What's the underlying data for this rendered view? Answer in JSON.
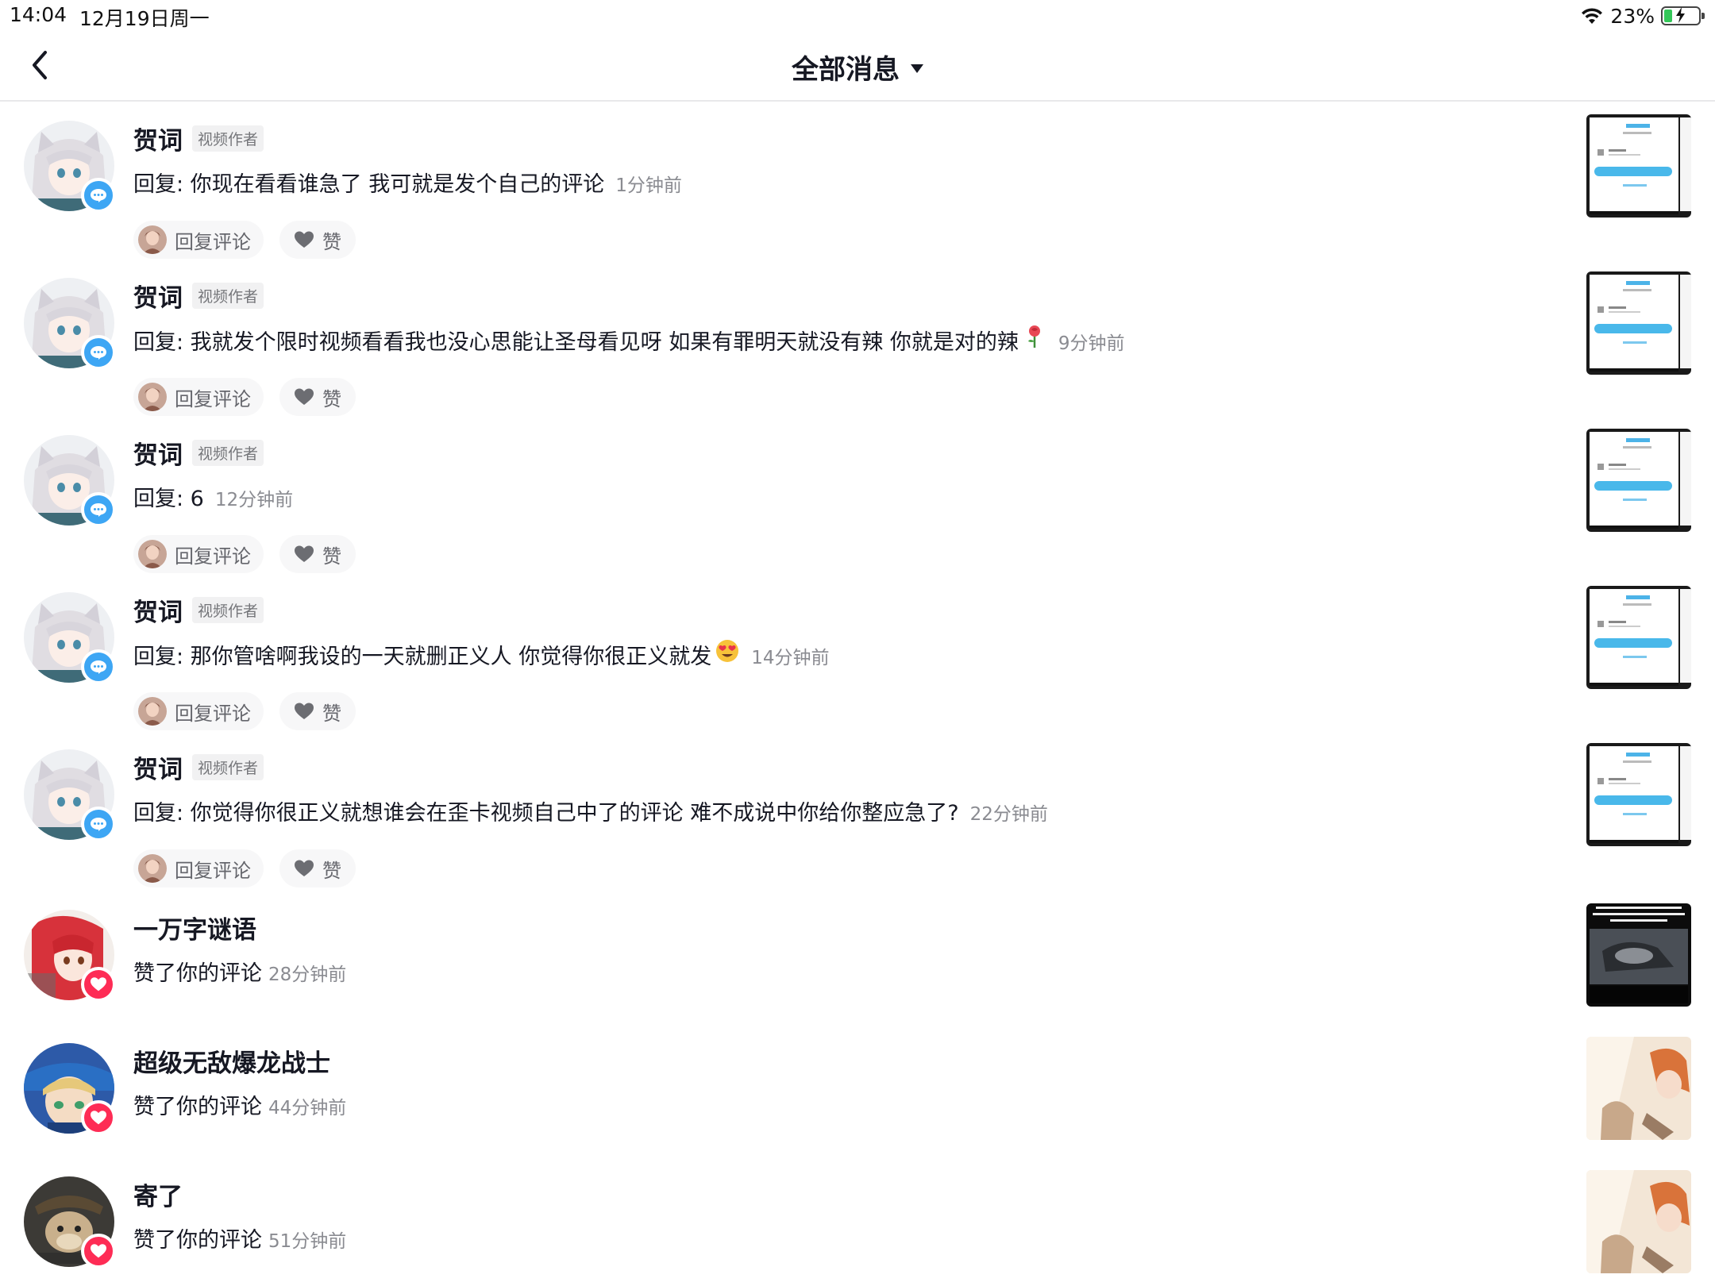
{
  "status_bar": {
    "time": "14:04",
    "date": "12月19日周一",
    "battery": "23%"
  },
  "nav": {
    "title": "全部消息"
  },
  "actions": {
    "reply_label": "回复评论",
    "like_label": "赞"
  },
  "author_tag": "视频作者",
  "messages": [
    {
      "username": "贺词",
      "content": "回复: 你现在看看谁急了 我可就是发个自己的评论",
      "time": "1分钟前"
    },
    {
      "username": "贺词",
      "content": "回复: 我就发个限时视频看看我也没心思能让圣母看见呀 如果有罪明天就没有辣 你就是对的辣",
      "time": "9分钟前"
    },
    {
      "username": "贺词",
      "content": "回复: 6",
      "time": "12分钟前"
    },
    {
      "username": "贺词",
      "content": "回复: 那你管啥啊我设的一天就删正义人 你觉得你很正义就发",
      "time": "14分钟前"
    },
    {
      "username": "贺词",
      "content": "回复: 你觉得你很正义就想谁会在歪卡视频自己中了的评论 难不成说中你给你整应急了?",
      "time": "22分钟前"
    },
    {
      "username": "一万字谜语",
      "content": "赞了你的评论",
      "time": "28分钟前"
    },
    {
      "username": "超级无敌爆龙战士",
      "content": "赞了你的评论",
      "time": "44分钟前"
    },
    {
      "username": "寄了",
      "content": "赞了你的评论",
      "time": "51分钟前"
    }
  ]
}
